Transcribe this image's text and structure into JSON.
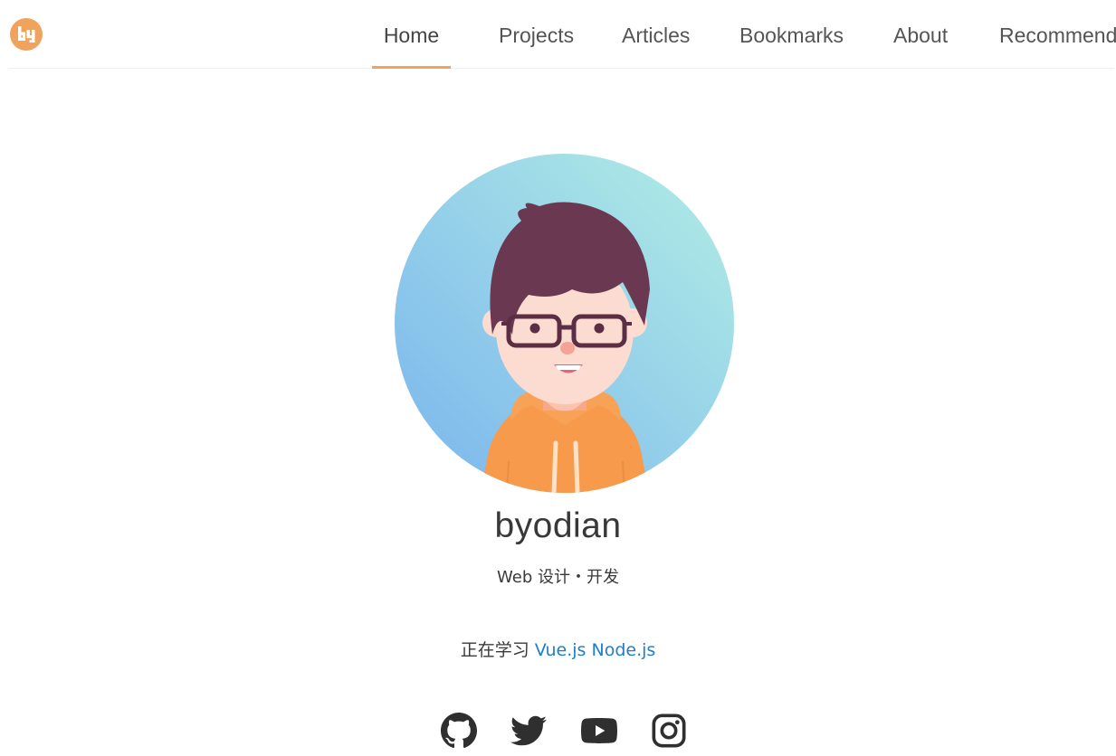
{
  "header": {
    "logo_text": "by",
    "nav": [
      {
        "label": "Home",
        "active": true
      },
      {
        "label": "Projects",
        "active": false
      },
      {
        "label": "Articles",
        "active": false
      },
      {
        "label": "Bookmarks",
        "active": false
      },
      {
        "label": "About",
        "active": false
      },
      {
        "label": "Recommend",
        "active": false
      }
    ]
  },
  "profile": {
    "name": "byodian",
    "tagline": "Web 设计・开发",
    "learning_prefix": "正在学习",
    "learning_links": [
      "Vue.js",
      "Node.js"
    ]
  },
  "social": [
    {
      "icon": "github-icon"
    },
    {
      "icon": "twitter-icon"
    },
    {
      "icon": "youtube-icon"
    },
    {
      "icon": "instagram-icon"
    }
  ],
  "colors": {
    "accent": "#f0a35c",
    "link": "#1f7ec9",
    "text": "#333333",
    "divider": "#eeeeee"
  }
}
